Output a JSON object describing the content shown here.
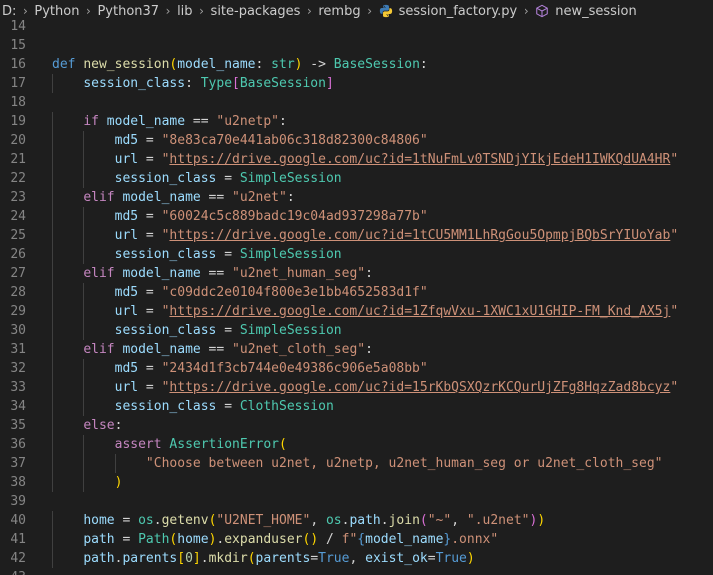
{
  "breadcrumb": {
    "items": [
      "D:",
      "Python",
      "Python37",
      "lib",
      "site-packages",
      "rembg",
      "session_factory.py",
      "new_session"
    ]
  },
  "editor": {
    "lines": [
      {
        "n": "14",
        "tokens": []
      },
      {
        "n": "15",
        "tokens": []
      },
      {
        "n": "16",
        "tokens": [
          [
            "kw",
            "def "
          ],
          [
            "fn",
            "new_session"
          ],
          [
            "par",
            "("
          ],
          [
            "var",
            "model_name"
          ],
          [
            "pun",
            ": "
          ],
          [
            "typ",
            "str"
          ],
          [
            "par",
            ")"
          ],
          [
            "op",
            " -> "
          ],
          [
            "typ",
            "BaseSession"
          ],
          [
            "pun",
            ":"
          ]
        ]
      },
      {
        "n": "17",
        "tokens": [
          [
            "pun",
            "    "
          ],
          [
            "var",
            "session_class"
          ],
          [
            "pun",
            ": "
          ],
          [
            "typ",
            "Type"
          ],
          [
            "par2",
            "["
          ],
          [
            "typ",
            "BaseSession"
          ],
          [
            "par2",
            "]"
          ]
        ]
      },
      {
        "n": "18",
        "tokens": []
      },
      {
        "n": "19",
        "tokens": [
          [
            "pun",
            "    "
          ],
          [
            "kwc",
            "if "
          ],
          [
            "var",
            "model_name"
          ],
          [
            "op",
            " == "
          ],
          [
            "str",
            "\"u2netp\""
          ],
          [
            "pun",
            ":"
          ]
        ]
      },
      {
        "n": "20",
        "tokens": [
          [
            "pun",
            "        "
          ],
          [
            "var",
            "md5"
          ],
          [
            "op",
            " = "
          ],
          [
            "str",
            "\"8e83ca70e441ab06c318d82300c84806\""
          ]
        ]
      },
      {
        "n": "21",
        "tokens": [
          [
            "pun",
            "        "
          ],
          [
            "var",
            "url"
          ],
          [
            "op",
            " = "
          ],
          [
            "str",
            "\""
          ],
          [
            "url",
            "https://drive.google.com/uc?id=1tNuFmLv0TSNDjYIkjEdeH1IWKQdUA4HR"
          ],
          [
            "str",
            "\""
          ]
        ]
      },
      {
        "n": "22",
        "tokens": [
          [
            "pun",
            "        "
          ],
          [
            "var",
            "session_class"
          ],
          [
            "op",
            " = "
          ],
          [
            "typ",
            "SimpleSession"
          ]
        ]
      },
      {
        "n": "23",
        "tokens": [
          [
            "pun",
            "    "
          ],
          [
            "kwc",
            "elif "
          ],
          [
            "var",
            "model_name"
          ],
          [
            "op",
            " == "
          ],
          [
            "str",
            "\"u2net\""
          ],
          [
            "pun",
            ":"
          ]
        ]
      },
      {
        "n": "24",
        "tokens": [
          [
            "pun",
            "        "
          ],
          [
            "var",
            "md5"
          ],
          [
            "op",
            " = "
          ],
          [
            "str",
            "\"60024c5c889badc19c04ad937298a77b\""
          ]
        ]
      },
      {
        "n": "25",
        "tokens": [
          [
            "pun",
            "        "
          ],
          [
            "var",
            "url"
          ],
          [
            "op",
            " = "
          ],
          [
            "str",
            "\""
          ],
          [
            "url",
            "https://drive.google.com/uc?id=1tCU5MM1LhRgGou5OpmpjBQbSrYIUoYab"
          ],
          [
            "str",
            "\""
          ]
        ]
      },
      {
        "n": "26",
        "tokens": [
          [
            "pun",
            "        "
          ],
          [
            "var",
            "session_class"
          ],
          [
            "op",
            " = "
          ],
          [
            "typ",
            "SimpleSession"
          ]
        ]
      },
      {
        "n": "27",
        "tokens": [
          [
            "pun",
            "    "
          ],
          [
            "kwc",
            "elif "
          ],
          [
            "var",
            "model_name"
          ],
          [
            "op",
            " == "
          ],
          [
            "str",
            "\"u2net_human_seg\""
          ],
          [
            "pun",
            ":"
          ]
        ]
      },
      {
        "n": "28",
        "tokens": [
          [
            "pun",
            "        "
          ],
          [
            "var",
            "md5"
          ],
          [
            "op",
            " = "
          ],
          [
            "str",
            "\"c09ddc2e0104f800e3e1bb4652583d1f\""
          ]
        ]
      },
      {
        "n": "29",
        "tokens": [
          [
            "pun",
            "        "
          ],
          [
            "var",
            "url"
          ],
          [
            "op",
            " = "
          ],
          [
            "str",
            "\""
          ],
          [
            "url",
            "https://drive.google.com/uc?id=1ZfqwVxu-1XWC1xU1GHIP-FM_Knd_AX5j"
          ],
          [
            "str",
            "\""
          ]
        ]
      },
      {
        "n": "30",
        "tokens": [
          [
            "pun",
            "        "
          ],
          [
            "var",
            "session_class"
          ],
          [
            "op",
            " = "
          ],
          [
            "typ",
            "SimpleSession"
          ]
        ]
      },
      {
        "n": "31",
        "tokens": [
          [
            "pun",
            "    "
          ],
          [
            "kwc",
            "elif "
          ],
          [
            "var",
            "model_name"
          ],
          [
            "op",
            " == "
          ],
          [
            "str",
            "\"u2net_cloth_seg\""
          ],
          [
            "pun",
            ":"
          ]
        ]
      },
      {
        "n": "32",
        "tokens": [
          [
            "pun",
            "        "
          ],
          [
            "var",
            "md5"
          ],
          [
            "op",
            " = "
          ],
          [
            "str",
            "\"2434d1f3cb744e0e49386c906e5a08bb\""
          ]
        ]
      },
      {
        "n": "33",
        "tokens": [
          [
            "pun",
            "        "
          ],
          [
            "var",
            "url"
          ],
          [
            "op",
            " = "
          ],
          [
            "str",
            "\""
          ],
          [
            "url",
            "https://drive.google.com/uc?id=15rKbQSXQzrKCQurUjZFg8HqzZad8bcyz"
          ],
          [
            "str",
            "\""
          ]
        ]
      },
      {
        "n": "34",
        "tokens": [
          [
            "pun",
            "        "
          ],
          [
            "var",
            "session_class"
          ],
          [
            "op",
            " = "
          ],
          [
            "typ",
            "ClothSession"
          ]
        ]
      },
      {
        "n": "35",
        "tokens": [
          [
            "pun",
            "    "
          ],
          [
            "kwc",
            "else"
          ],
          [
            "pun",
            ":"
          ]
        ]
      },
      {
        "n": "36",
        "tokens": [
          [
            "pun",
            "        "
          ],
          [
            "kwc",
            "assert "
          ],
          [
            "typ",
            "AssertionError"
          ],
          [
            "par",
            "("
          ]
        ]
      },
      {
        "n": "37",
        "tokens": [
          [
            "pun",
            "            "
          ],
          [
            "str",
            "\"Choose between u2net, u2netp, u2net_human_seg or u2net_cloth_seg\""
          ]
        ]
      },
      {
        "n": "38",
        "tokens": [
          [
            "pun",
            "        "
          ],
          [
            "par",
            ")"
          ]
        ]
      },
      {
        "n": "39",
        "tokens": []
      },
      {
        "n": "40",
        "tokens": [
          [
            "pun",
            "    "
          ],
          [
            "var",
            "home"
          ],
          [
            "op",
            " = "
          ],
          [
            "typ",
            "os"
          ],
          [
            "pun",
            "."
          ],
          [
            "fn",
            "getenv"
          ],
          [
            "par",
            "("
          ],
          [
            "str",
            "\"U2NET_HOME\""
          ],
          [
            "pun",
            ", "
          ],
          [
            "typ",
            "os"
          ],
          [
            "pun",
            "."
          ],
          [
            "var",
            "path"
          ],
          [
            "pun",
            "."
          ],
          [
            "fn",
            "join"
          ],
          [
            "par2",
            "("
          ],
          [
            "str",
            "\"~\""
          ],
          [
            "pun",
            ", "
          ],
          [
            "str",
            "\".u2net\""
          ],
          [
            "par2",
            ")"
          ],
          [
            "par",
            ")"
          ]
        ]
      },
      {
        "n": "41",
        "tokens": [
          [
            "pun",
            "    "
          ],
          [
            "var",
            "path"
          ],
          [
            "op",
            " = "
          ],
          [
            "typ",
            "Path"
          ],
          [
            "par",
            "("
          ],
          [
            "var",
            "home"
          ],
          [
            "par",
            ")"
          ],
          [
            "pun",
            "."
          ],
          [
            "fn",
            "expanduser"
          ],
          [
            "par",
            "()"
          ],
          [
            "op",
            " / "
          ],
          [
            "str",
            "f\""
          ],
          [
            "lit",
            "{"
          ],
          [
            "var",
            "model_name"
          ],
          [
            "lit",
            "}"
          ],
          [
            "str",
            ".onnx\""
          ]
        ]
      },
      {
        "n": "42",
        "tokens": [
          [
            "pun",
            "    "
          ],
          [
            "var",
            "path"
          ],
          [
            "pun",
            "."
          ],
          [
            "var",
            "parents"
          ],
          [
            "par",
            "["
          ],
          [
            "num",
            "0"
          ],
          [
            "par",
            "]"
          ],
          [
            "pun",
            "."
          ],
          [
            "fn",
            "mkdir"
          ],
          [
            "par",
            "("
          ],
          [
            "var",
            "parents"
          ],
          [
            "op",
            "="
          ],
          [
            "lit",
            "True"
          ],
          [
            "pun",
            ", "
          ],
          [
            "var",
            "exist_ok"
          ],
          [
            "op",
            "="
          ],
          [
            "lit",
            "True"
          ],
          [
            "par",
            ")"
          ]
        ]
      },
      {
        "n": "43",
        "tokens": []
      }
    ]
  }
}
